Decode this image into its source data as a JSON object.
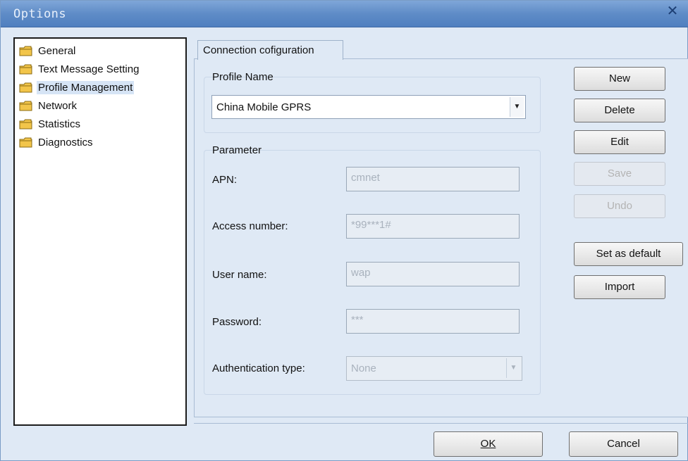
{
  "window": {
    "title": "Options",
    "close_label": "✕"
  },
  "nav": {
    "items": [
      {
        "label": "General",
        "icon": "folder-icon",
        "selected": false
      },
      {
        "label": "Text Message Setting",
        "icon": "folder-icon",
        "selected": false
      },
      {
        "label": "Profile Management",
        "icon": "folder-icon",
        "selected": true
      },
      {
        "label": "Network",
        "icon": "folder-icon",
        "selected": false
      },
      {
        "label": "Statistics",
        "icon": "folder-icon",
        "selected": false
      },
      {
        "label": "Diagnostics",
        "icon": "folder-icon",
        "selected": false
      }
    ]
  },
  "tab": {
    "label": "Connection cofiguration"
  },
  "profile": {
    "group_label": "Profile Name",
    "selected_value": "China Mobile GPRS"
  },
  "parameter": {
    "group_label": "Parameter",
    "apn_label": "APN:",
    "apn_value": "cmnet",
    "access_label": "Access number:",
    "access_value": "*99***1#",
    "user_label": "User name:",
    "user_value": "wap",
    "password_label": "Password:",
    "password_value": "***",
    "auth_label": "Authentication type:",
    "auth_value": "None"
  },
  "buttons": {
    "new": "New",
    "delete": "Delete",
    "edit": "Edit",
    "save": "Save",
    "undo": "Undo",
    "set_default": "Set as default",
    "import": "Import"
  },
  "footer": {
    "ok": "OK",
    "cancel": "Cancel"
  },
  "colors": {
    "accent": "#5f8cc7",
    "background": "#dfe9f5",
    "folder": "#f2c54a"
  }
}
